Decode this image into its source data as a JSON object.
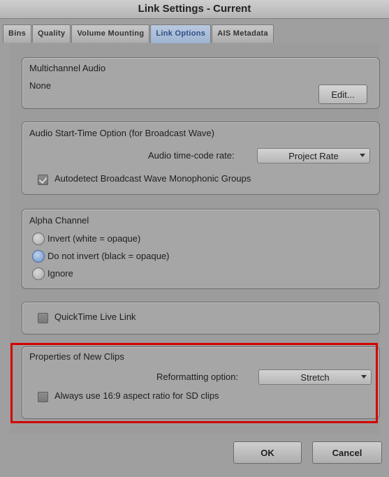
{
  "window": {
    "title": "Link Settings - Current"
  },
  "tabs": [
    {
      "label": "Bins",
      "active": false
    },
    {
      "label": "Quality",
      "active": false
    },
    {
      "label": "Volume Mounting",
      "active": false
    },
    {
      "label": "Link Options",
      "active": true
    },
    {
      "label": "AIS Metadata",
      "active": false
    }
  ],
  "multichannel": {
    "title": "Multichannel Audio",
    "value": "None",
    "edit_label": "Edit..."
  },
  "audio_start": {
    "title": "Audio Start-Time Option (for Broadcast Wave)",
    "rate_label": "Audio time-code rate:",
    "rate_value": "Project Rate",
    "autodetect_label": "Autodetect Broadcast Wave Monophonic Groups",
    "autodetect_checked": true
  },
  "alpha": {
    "title": "Alpha Channel",
    "options": [
      {
        "label": "Invert (white = opaque)",
        "selected": false
      },
      {
        "label": "Do not invert (black = opaque)",
        "selected": true
      },
      {
        "label": "Ignore",
        "selected": false
      }
    ]
  },
  "quicktime": {
    "label": "QuickTime Live Link",
    "checked": false
  },
  "new_clips": {
    "title": "Properties of New Clips",
    "reformat_label": "Reformatting option:",
    "reformat_value": "Stretch",
    "aspect_label": "Always use 16:9 aspect ratio for SD clips",
    "aspect_checked": false
  },
  "footer": {
    "ok_label": "OK",
    "cancel_label": "Cancel"
  },
  "colors": {
    "highlight": "#d40000",
    "active_tab": "#9db2d0"
  }
}
